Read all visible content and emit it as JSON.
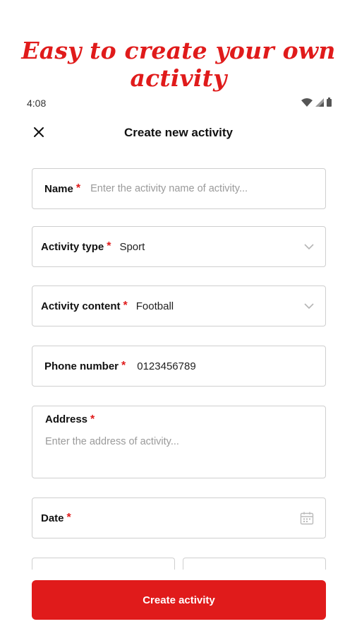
{
  "promo": {
    "headline": "Easy to create your own activity"
  },
  "status_bar": {
    "time": "4:08",
    "icons": [
      "wifi-icon",
      "signal-icon",
      "battery-icon"
    ]
  },
  "header": {
    "title": "Create new activity",
    "close_icon": "close-icon"
  },
  "form": {
    "required_mark": "*",
    "name": {
      "label": "Name",
      "placeholder": "Enter the activity name of activity..."
    },
    "activity_type": {
      "label": "Activity type",
      "value": "Sport"
    },
    "activity_content": {
      "label": "Activity content",
      "value": "Football"
    },
    "phone_number": {
      "label": "Phone number",
      "value": "0123456789"
    },
    "address": {
      "label": "Address",
      "placeholder": "Enter the address of activity..."
    },
    "date": {
      "label": "Date",
      "icon": "calendar-icon"
    }
  },
  "actions": {
    "create_label": "Create activity"
  },
  "colors": {
    "accent": "#e01b1b",
    "border": "#cfcfcf",
    "placeholder": "#9a9a9a"
  }
}
